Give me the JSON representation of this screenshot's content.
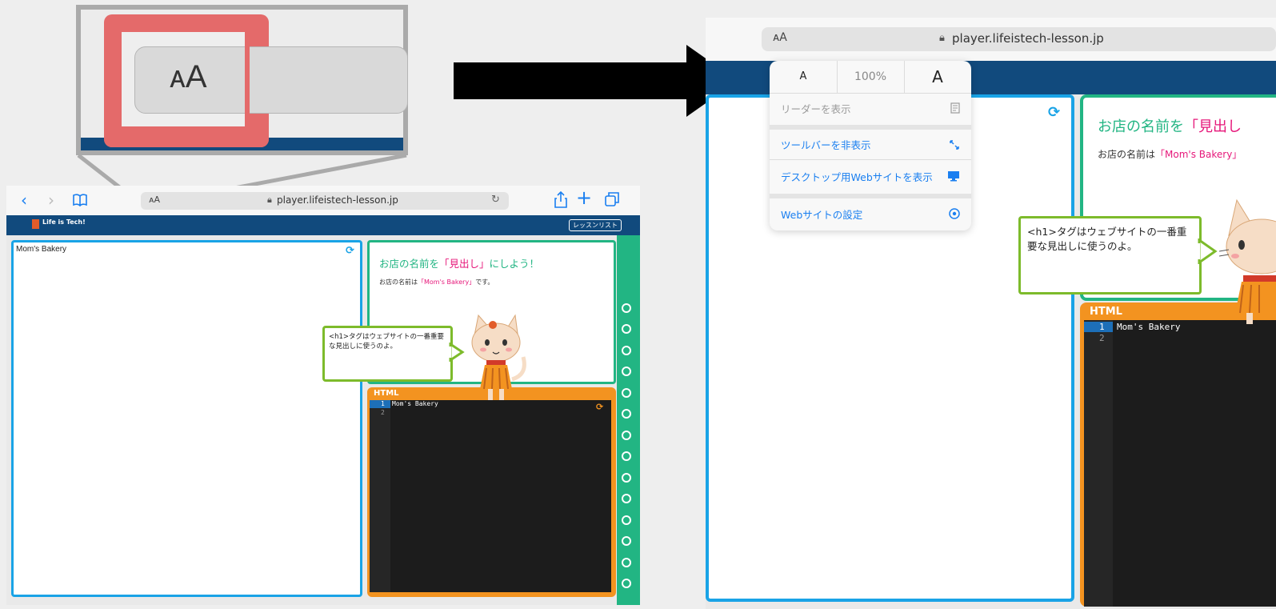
{
  "zoom_inset": {
    "aa_label": "ᴀA"
  },
  "left_shot": {
    "address": {
      "aa_label": "ᴀA",
      "url": "player.lifeistech-lesson.jp"
    },
    "header": {
      "logo_text": "Life is Tech!",
      "lesson_list_button": "レッスンリスト"
    },
    "preview": {
      "text": "Mom's Bakery"
    },
    "instruction": {
      "title_part1": "お店の名前を",
      "title_highlight": "「見出し」",
      "title_part2": "にしよう！",
      "body_part1": "お店の名前は",
      "body_highlight": "「Mom's Bakery」",
      "body_part2": "です。"
    },
    "bubble_text": "<h1>タグはウェブサイトの一番重要な見出しに使うのよ。",
    "editor": {
      "label": "HTML",
      "lines": [
        {
          "num": "1",
          "code": "Mom's Bakery"
        },
        {
          "num": "2",
          "code": ""
        }
      ]
    }
  },
  "right_shot": {
    "address": {
      "aa_label": "ᴀA",
      "url": "player.lifeistech-lesson.jp"
    },
    "menu": {
      "small_a": "A",
      "zoom": "100%",
      "large_a": "A",
      "show_reader": "リーダーを表示",
      "hide_toolbar": "ツールバーを非表示",
      "desktop_site": "デスクトップ用Webサイトを表示",
      "website_settings": "Webサイトの設定"
    },
    "instruction": {
      "title_part1": "お店の名前を",
      "title_highlight": "「見出し",
      "body_part1": "お店の名前は",
      "body_highlight": "「Mom's Bakery」"
    },
    "bubble_text": "<h1>タグはウェブサイトの一番重要な見出しに使うのよ。",
    "editor": {
      "label": "HTML",
      "lines": [
        {
          "num": "1",
          "code": "Mom's Bakery"
        },
        {
          "num": "2",
          "code": ""
        }
      ]
    }
  },
  "colors": {
    "accent_blue": "#19a3e6",
    "green": "#22b583",
    "orange": "#f39320",
    "pink": "#e6177a",
    "navy": "#114a7d",
    "bubble_border": "#7dbb2b",
    "callout_red": "#e46a6a"
  }
}
